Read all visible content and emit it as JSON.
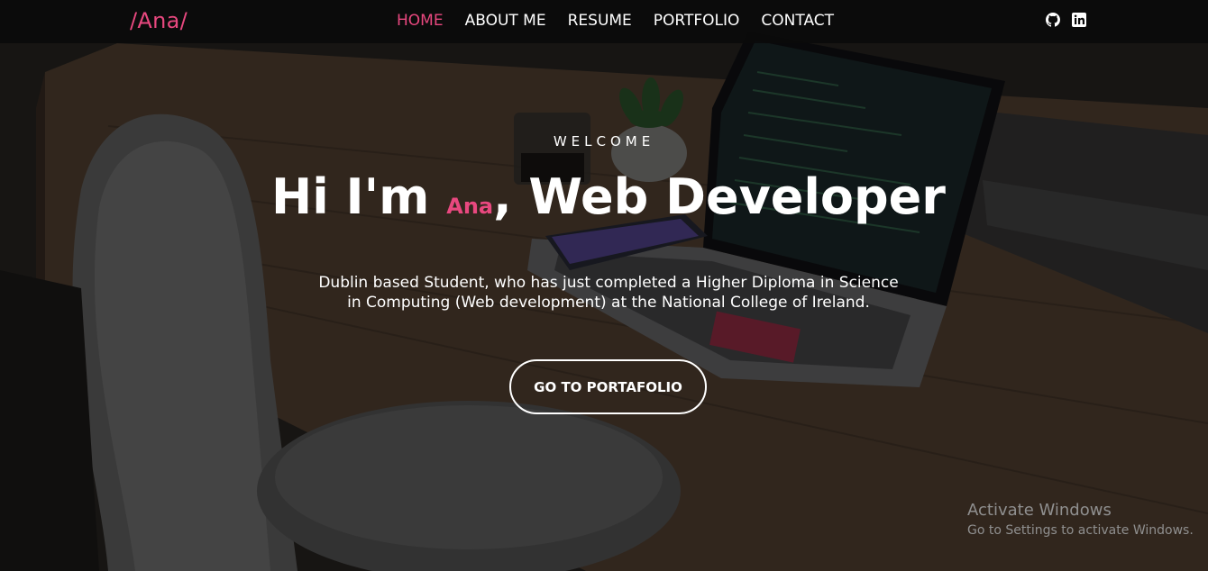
{
  "nav": {
    "brand": "/Ana/",
    "items": [
      {
        "label": "HOME",
        "active": true
      },
      {
        "label": "ABOUT ME",
        "active": false
      },
      {
        "label": "RESUME",
        "active": false
      },
      {
        "label": "PORTFOLIO",
        "active": false
      },
      {
        "label": "CONTACT",
        "active": false
      }
    ],
    "social": [
      "github-icon",
      "linkedin-icon"
    ]
  },
  "hero": {
    "welcome": "WELCOME",
    "title_prefix": "Hi I'm ",
    "title_name": "Ana",
    "title_suffix": ", Web Developer",
    "description_line1": "Dublin based Student, who has just completed a Higher Diploma in Science",
    "description_line2": "in Computing (Web development) at the National College of Ireland.",
    "cta_label": "GO TO PORTAFOLIO"
  },
  "watermark": {
    "title": "Activate Windows",
    "subtitle": "Go to Settings to activate Windows."
  },
  "colors": {
    "accent": "#e8487f",
    "nav_bg": "#0a0a0a",
    "text": "#ffffff"
  }
}
